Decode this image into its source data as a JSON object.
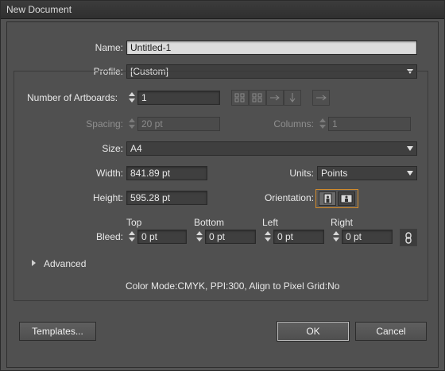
{
  "window": {
    "title": "New Document"
  },
  "name": {
    "label": "Name:",
    "value": "Untitled-1"
  },
  "profile": {
    "label": "Profile:",
    "value": "[Custom]"
  },
  "artboards": {
    "label": "Number of Artboards:",
    "value": "1"
  },
  "spacing": {
    "label": "Spacing:",
    "value": "20 pt"
  },
  "columns": {
    "label": "Columns:",
    "value": "1"
  },
  "size": {
    "label": "Size:",
    "value": "A4"
  },
  "width": {
    "label": "Width:",
    "value": "841.89 pt"
  },
  "units": {
    "label": "Units:",
    "value": "Points"
  },
  "height": {
    "label": "Height:",
    "value": "595.28 pt"
  },
  "orientation": {
    "label": "Orientation:"
  },
  "bleed": {
    "label": "Bleed:",
    "top": {
      "label": "Top",
      "value": "0 pt"
    },
    "bottom": {
      "label": "Bottom",
      "value": "0 pt"
    },
    "left": {
      "label": "Left",
      "value": "0 pt"
    },
    "right": {
      "label": "Right",
      "value": "0 pt"
    }
  },
  "advanced": {
    "label": "Advanced"
  },
  "summary": "Color Mode:CMYK, PPI:300, Align to Pixel Grid:No",
  "buttons": {
    "templates": "Templates...",
    "ok": "OK",
    "cancel": "Cancel"
  },
  "icons": [
    "grid-by-row-icon",
    "grid-by-column-icon",
    "arrange-by-row-icon",
    "arrange-by-column-icon",
    "right-to-left-icon",
    "portrait-icon",
    "landscape-icon",
    "link-icon",
    "chevron-down-icon",
    "disclosure-triangle-icon"
  ],
  "colors": {
    "accent": "#d08a2c",
    "background": "#535353"
  }
}
